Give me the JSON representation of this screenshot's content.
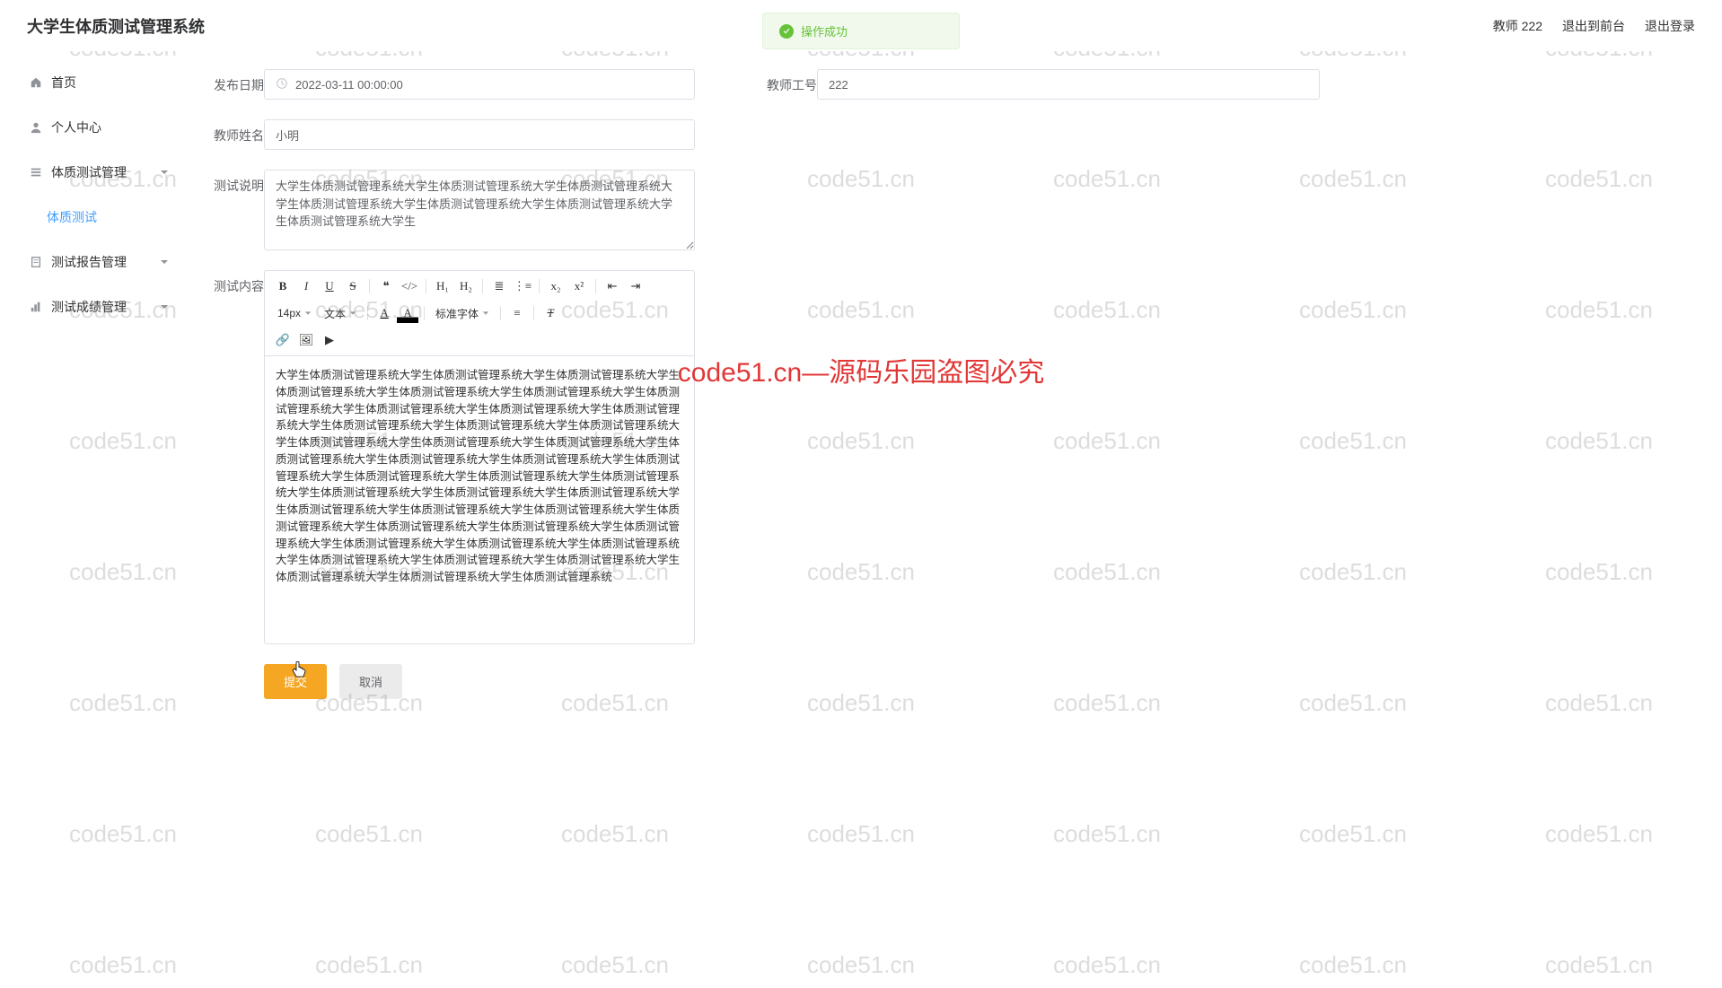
{
  "header": {
    "title": "大学生体质测试管理系统",
    "user_label": "教师 222",
    "exit_front": "退出到前台",
    "logout": "退出登录"
  },
  "toast": {
    "text": "操作成功"
  },
  "sidebar": {
    "items": [
      {
        "label": "首页",
        "icon": "home"
      },
      {
        "label": "个人中心",
        "icon": "user"
      },
      {
        "label": "体质测试管理",
        "icon": "list",
        "expandable": true
      },
      {
        "label": "体质测试",
        "icon": "",
        "child": true
      },
      {
        "label": "测试报告管理",
        "icon": "report",
        "expandable": true
      },
      {
        "label": "测试成绩管理",
        "icon": "bar",
        "expandable": true
      }
    ]
  },
  "form": {
    "publish_date_label": "发布日期",
    "publish_date_value": "2022-03-11 00:00:00",
    "teacher_id_label": "教师工号",
    "teacher_id_value": "222",
    "teacher_name_label": "教师姓名",
    "teacher_name_value": "小明",
    "test_desc_label": "测试说明",
    "test_desc_value": "大学生体质测试管理系统大学生体质测试管理系统大学生体质测试管理系统大学生体质测试管理系统大学生体质测试管理系统大学生体质测试管理系统大学生体质测试管理系统大学生",
    "test_content_label": "测试内容",
    "test_content_value": "大学生体质测试管理系统大学生体质测试管理系统大学生体质测试管理系统大学生体质测试管理系统大学生体质测试管理系统大学生体质测试管理系统大学生体质测试管理系统大学生体质测试管理系统大学生体质测试管理系统大学生体质测试管理系统大学生体质测试管理系统大学生体质测试管理系统大学生体质测试管理系统大学生体质测试管理系统大学生体质测试管理系统大学生体质测试管理系统大学生体质测试管理系统大学生体质测试管理系统大学生体质测试管理系统大学生体质测试管理系统大学生体质测试管理系统大学生体质测试管理系统大学生体质测试管理系统大学生体质测试管理系统大学生体质测试管理系统大学生体质测试管理系统大学生体质测试管理系统大学生体质测试管理系统大学生体质测试管理系统大学生体质测试管理系统大学生体质测试管理系统大学生体质测试管理系统大学生体质测试管理系统大学生体质测试管理系统大学生体质测试管理系统大学生体质测试管理系统大学生体质测试管理系统大学生体质测试管理系统大学生体质测试管理系统大学生体质测试管理系统大学生体质测试管理系统大学生体质测试管理系统"
  },
  "editor_toolbar": {
    "font_size": "14px",
    "paragraph": "文本",
    "font_family": "标准字体"
  },
  "actions": {
    "submit": "提交",
    "cancel": "取消"
  },
  "watermark": {
    "text": "code51.cn",
    "center": "code51.cn—源码乐园盗图必究"
  }
}
